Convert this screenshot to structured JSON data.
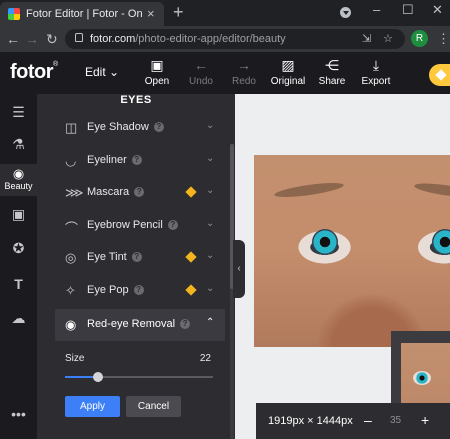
{
  "browser": {
    "tab_title": "Fotor Editor | Fotor - Online Fo",
    "tab_close": "×",
    "new_tab": "+",
    "minimize": "–",
    "maximize": "☐",
    "close": "✕",
    "url_domain": "fotor.com",
    "url_path": "/photo-editor-app/editor/beauty",
    "profile_initial": "R"
  },
  "app": {
    "logo": "fotor",
    "edit_menu": "Edit",
    "toolbar": [
      {
        "label": "Open",
        "icon": "image-upload-icon",
        "enabled": true
      },
      {
        "label": "Undo",
        "icon": "arrow-left-icon",
        "enabled": false
      },
      {
        "label": "Redo",
        "icon": "arrow-right-icon",
        "enabled": false
      },
      {
        "label": "Original",
        "icon": "image-icon",
        "enabled": true
      },
      {
        "label": "Share",
        "icon": "share-icon",
        "enabled": true
      },
      {
        "label": "Export",
        "icon": "download-icon",
        "enabled": true
      }
    ]
  },
  "rail": {
    "items": [
      {
        "name": "adjust",
        "icon": "sliders-icon"
      },
      {
        "name": "effects",
        "icon": "flask-icon"
      },
      {
        "name": "beauty",
        "label": "Beauty",
        "icon": "eye-icon",
        "active": true
      },
      {
        "name": "frames",
        "icon": "frame-icon"
      },
      {
        "name": "stickers",
        "icon": "sticker-icon"
      },
      {
        "name": "text",
        "icon": "text-icon"
      },
      {
        "name": "cloud",
        "icon": "cloud-upload-icon"
      },
      {
        "name": "more",
        "icon": "more-icon"
      }
    ]
  },
  "panel": {
    "section_title": "EYES",
    "items": [
      {
        "label": "Eye Shadow",
        "help": "?",
        "premium": false
      },
      {
        "label": "Eyeliner",
        "help": "?",
        "premium": false
      },
      {
        "label": "Mascara",
        "help": "?",
        "premium": true
      },
      {
        "label": "Eyebrow Pencil",
        "help": "?",
        "premium": false
      },
      {
        "label": "Eye Tint",
        "help": "?",
        "premium": true
      },
      {
        "label": "Eye Pop",
        "help": "?",
        "premium": true
      },
      {
        "label": "Red-eye Removal",
        "help": "?",
        "premium": false,
        "expanded": true
      }
    ],
    "size_label": "Size",
    "size_value": "22",
    "size_fraction": 0.22,
    "apply_label": "Apply",
    "cancel_label": "Cancel"
  },
  "canvas": {
    "dimensions": "1919px × 1444px",
    "zoom_minus": "–",
    "zoom_value": "35",
    "zoom_plus": "+"
  },
  "colors": {
    "accent": "#3d7ff6",
    "premium": "#f2b51e",
    "panel_bg": "#2c2c31"
  }
}
